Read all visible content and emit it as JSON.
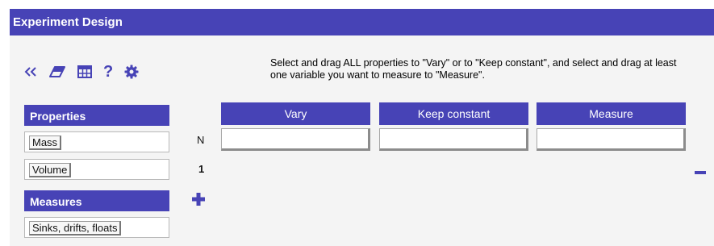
{
  "window": {
    "title": "Experiment Design"
  },
  "toolbar": {
    "collapse_icon": "double-chevron-left-icon",
    "eraser_icon": "eraser-icon",
    "table_icon": "table-icon",
    "help_label": "?",
    "settings_icon": "gear-icon"
  },
  "instructions": "Select and drag ALL properties to \"Vary\" or to \"Keep constant\", and select and drag at least one variable you want to measure to \"Measure\".",
  "properties": {
    "header": "Properties",
    "items": [
      {
        "label": "Mass"
      },
      {
        "label": "Volume"
      }
    ]
  },
  "measures": {
    "header": "Measures",
    "items": [
      {
        "label": "Sinks, drifts, floats"
      }
    ]
  },
  "table": {
    "columns": [
      {
        "label": "Vary"
      },
      {
        "label": "Keep constant"
      },
      {
        "label": "Measure"
      }
    ],
    "row_header_label": "N",
    "row_number": "1"
  },
  "buttons": {
    "add_icon": "plus-icon",
    "remove_icon": "minus-icon"
  },
  "colors": {
    "accent": "#4743b6",
    "panel": "#f4f4f4"
  }
}
